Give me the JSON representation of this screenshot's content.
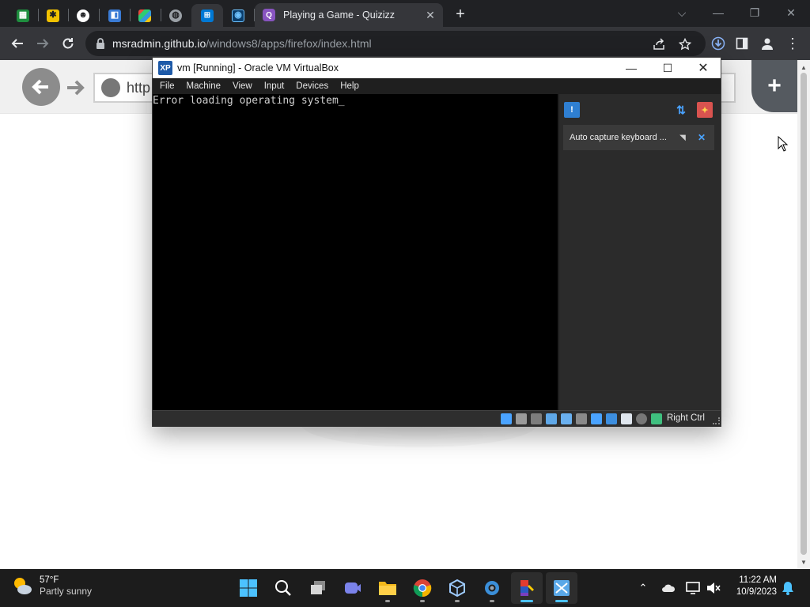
{
  "browser": {
    "pinned_tab_icons": [
      "spreadsheet-icon",
      "settings-gear-icon",
      "mask-icon",
      "windows-app-icon",
      "windows-xp-icon",
      "globe-icon",
      "windows-logo-icon",
      "virtualbox-icon"
    ],
    "active_tab": {
      "title": "Playing a Game - Quizizz",
      "icon": "quizizz-icon"
    },
    "url_host": "msradmin.github.io",
    "url_path": "/windows8/apps/firefox/index.html",
    "colors": {
      "tab_strip": "#202124",
      "toolbar": "#35363a"
    }
  },
  "page": {
    "url_text": "http",
    "add_tab_label": "+"
  },
  "virtualbox": {
    "title": "vm [Running] - Oracle VM VirtualBox",
    "menu": [
      "File",
      "Machine",
      "View",
      "Input",
      "Devices",
      "Help"
    ],
    "console_text": "Error loading operating system_",
    "notice_text": "Auto capture keyboard ...",
    "status_host_key": "Right Ctrl"
  },
  "taskbar": {
    "weather_temp": "57°F",
    "weather_desc": "Partly sunny",
    "time": "11:22 AM",
    "date": "10/9/2023",
    "apps": [
      "start-icon",
      "search-icon",
      "task-view-icon",
      "teams-chat-icon",
      "file-explorer-icon",
      "chrome-icon",
      "virtualbox-icon",
      "settings-icon",
      "winrar-icon",
      "windows-xp-icon"
    ],
    "accent_color": "#4cc2ff"
  }
}
